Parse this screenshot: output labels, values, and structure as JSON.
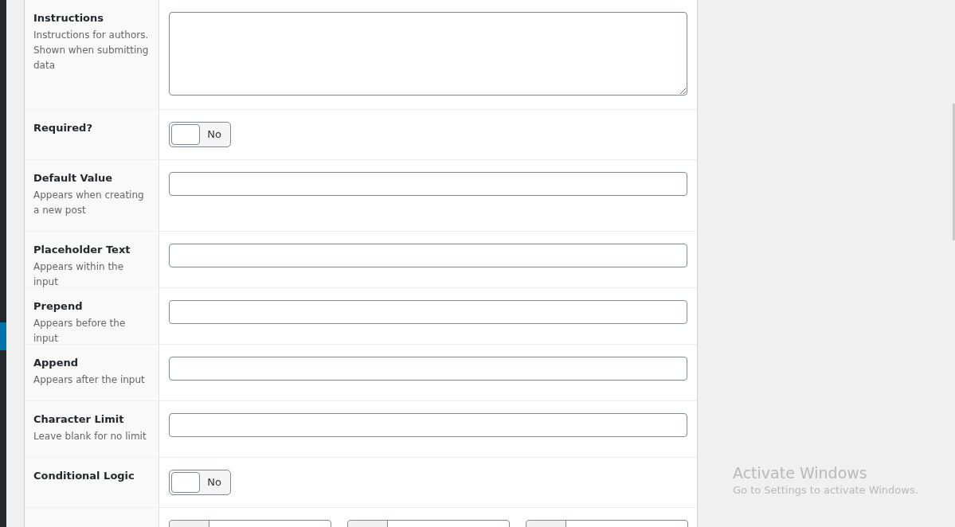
{
  "fields": [
    {
      "kind": "textarea",
      "label": "Instructions",
      "description": "Instructions for authors. Shown when submitting data"
    },
    {
      "kind": "toggle",
      "label": "Required?",
      "on": false,
      "state_text": "No"
    },
    {
      "kind": "text",
      "label": "Default Value",
      "description": "Appears when creating a new post"
    },
    {
      "kind": "text",
      "label": "Placeholder Text",
      "description": "Appears within the input"
    },
    {
      "kind": "text",
      "label": "Prepend",
      "description": "Appears before the input"
    },
    {
      "kind": "text",
      "label": "Append",
      "description": "Appears after the input"
    },
    {
      "kind": "text",
      "label": "Character Limit",
      "description": "Leave blank for no limit"
    },
    {
      "kind": "toggle",
      "label": "Conditional Logic",
      "on": false,
      "state_text": "No"
    },
    {
      "kind": "group"
    }
  ],
  "activation_notice": {
    "title": "Activate Windows",
    "message": "Go to Settings to activate Windows."
  }
}
